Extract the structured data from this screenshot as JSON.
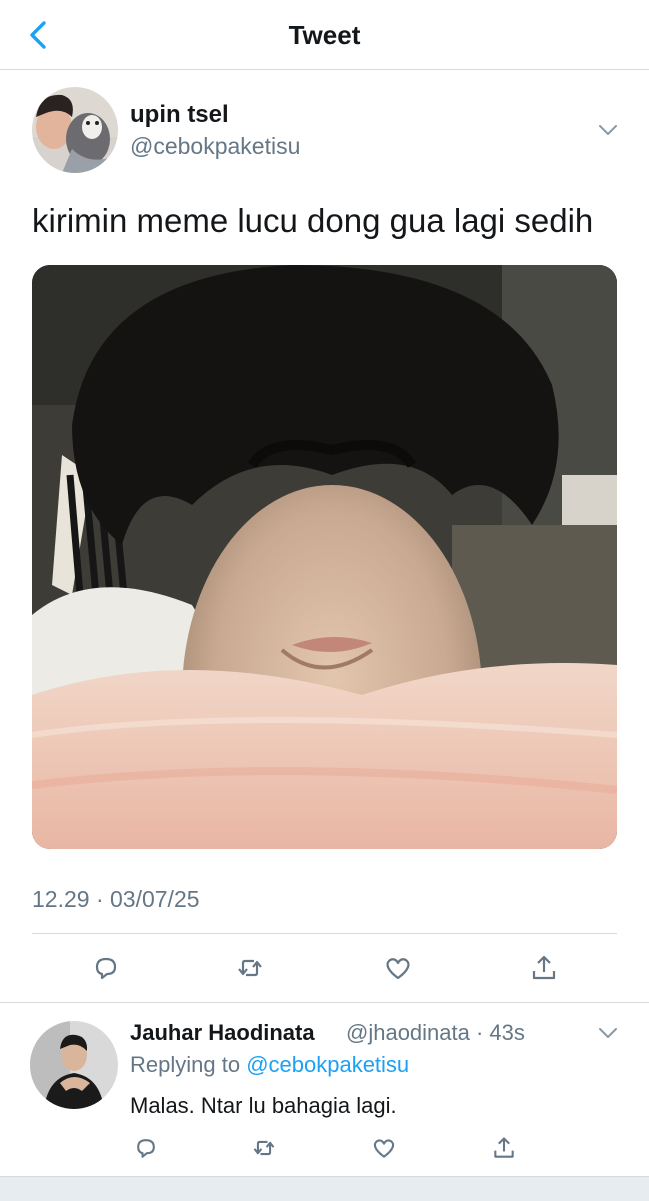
{
  "header": {
    "title": "Tweet",
    "back_icon": "chevron-left-icon",
    "accent": "#1da1f2"
  },
  "tweet": {
    "author_name": "upin tsel",
    "author_handle": "@cebokpaketisu",
    "text": "kirimin meme lucu dong gua lagi sedih",
    "timestamp": "12.29 · 03/07/25",
    "actions": [
      "reply-icon",
      "retweet-icon",
      "like-icon",
      "share-icon"
    ]
  },
  "reply": {
    "author_name": "Jauhar Haodinata",
    "meta": "@jhaodinata · 43s",
    "replying_prefix": "Replying to ",
    "replying_handle": "@cebokpaketisu",
    "text": "Malas. Ntar lu bahagia lagi.",
    "actions": [
      "reply-icon",
      "retweet-icon",
      "like-icon",
      "share-icon"
    ]
  },
  "colors": {
    "link": "#1da1f2",
    "secondary_text": "#657786",
    "border": "#d6dade"
  }
}
